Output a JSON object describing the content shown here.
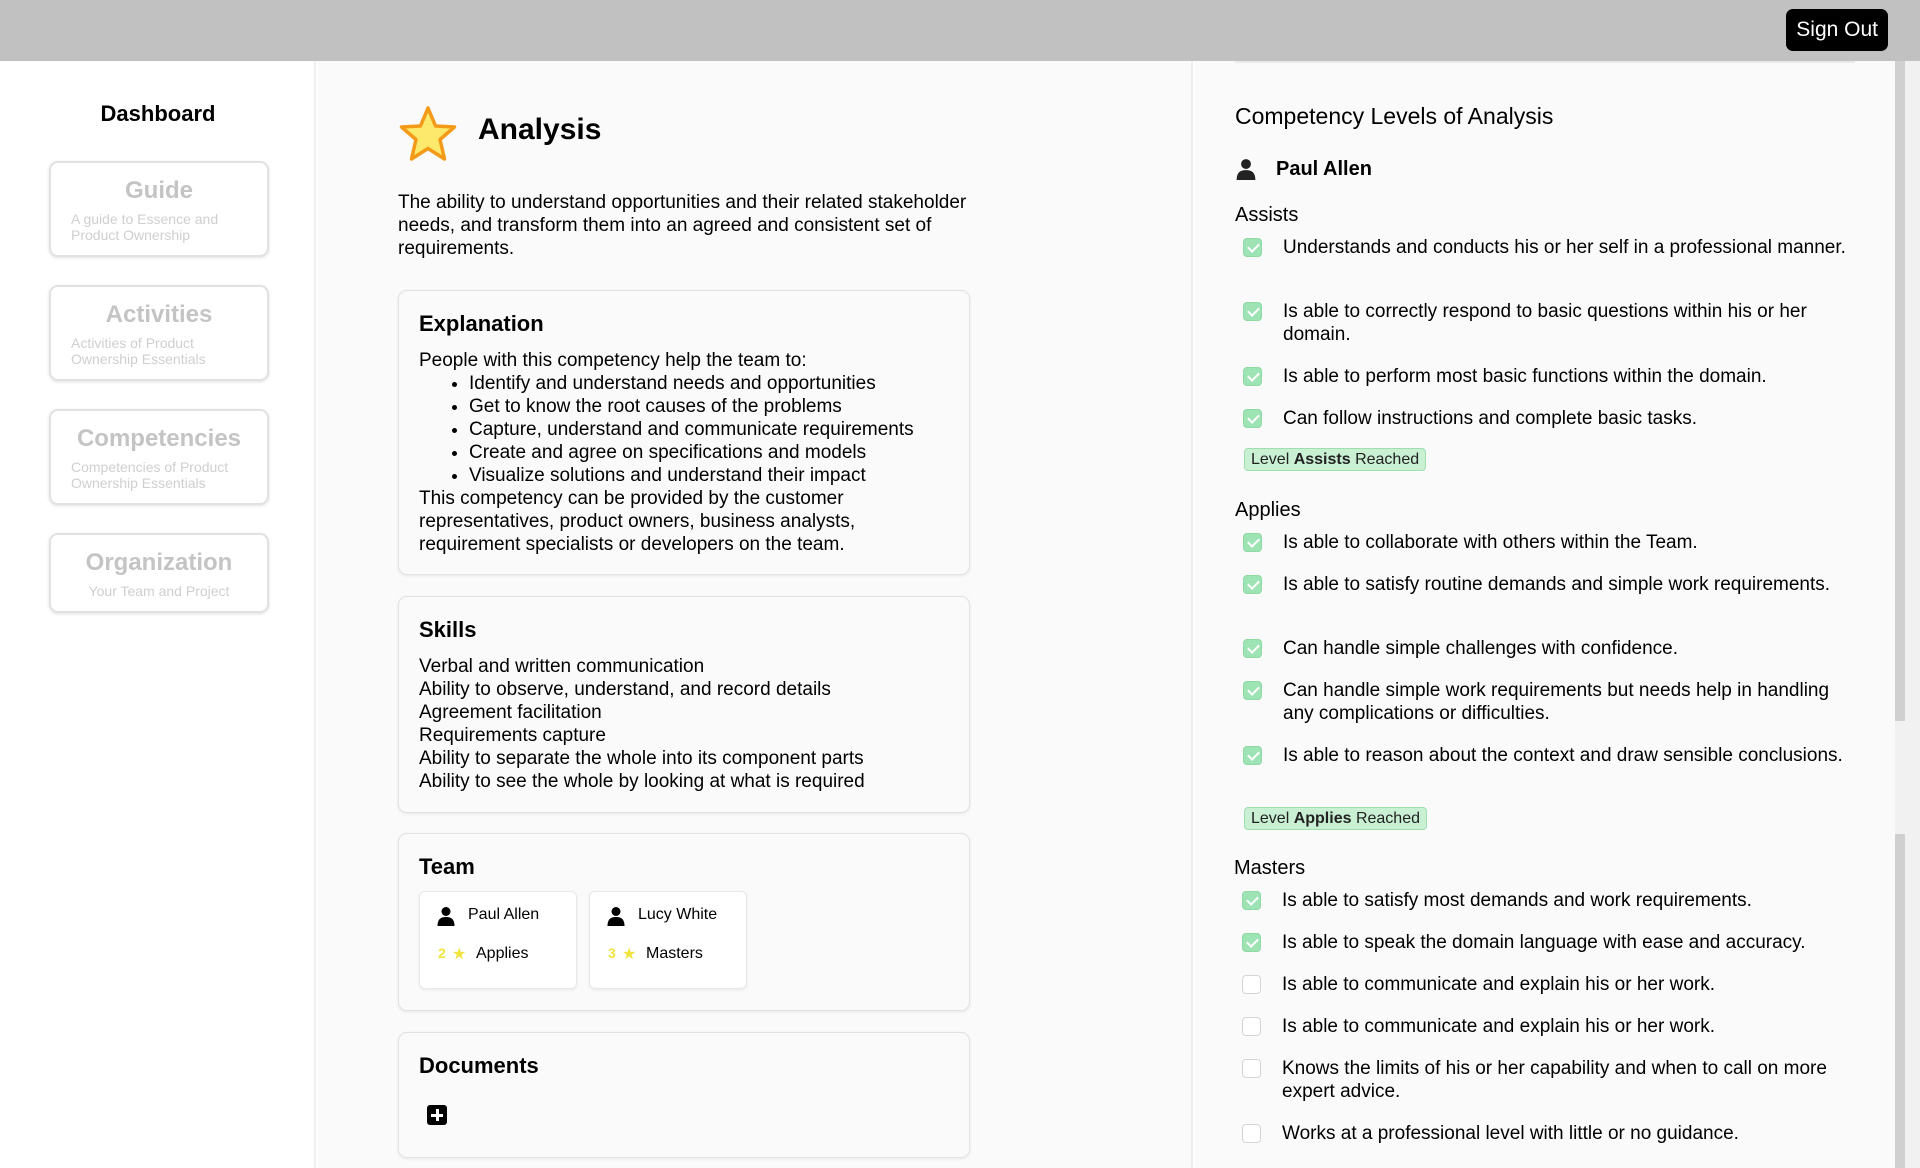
{
  "header": {
    "sign_out": "Sign Out"
  },
  "sidebar": {
    "title": "Dashboard",
    "items": [
      {
        "title": "Guide",
        "subtitle": "A guide to Essence and Product Ownership"
      },
      {
        "title": "Activities",
        "subtitle": "Activities of Product Ownership Essentials"
      },
      {
        "title": "Competencies",
        "subtitle": "Competencies of Product Ownership Essentials"
      },
      {
        "title": "Organization",
        "subtitle": "Your Team and Project"
      }
    ]
  },
  "main": {
    "icon": "star-icon",
    "title": "Analysis",
    "description": "The ability to understand opportunities and their related stakeholder needs, and transform them into an agreed and consistent set of requirements.",
    "explanation": {
      "heading": "Explanation",
      "intro": "People with this competency help the team to:",
      "bullets": [
        "Identify and understand needs and opportunities",
        "Get to know the root causes of the problems",
        "Capture, understand and communicate requirements",
        "Create and agree on specifications and models",
        "Visualize solutions and understand their impact"
      ],
      "outro": "This competency can be provided by the customer representatives, product owners, business analysts, requirement specialists or developers on the team."
    },
    "skills": {
      "heading": "Skills",
      "items": [
        "Verbal and written communication",
        "Ability to observe, understand, and record details",
        "Agreement facilitation",
        "Requirements capture",
        "Ability to separate the whole into its component parts",
        "Ability to see the whole by looking at what is required"
      ]
    },
    "team": {
      "heading": "Team",
      "members": [
        {
          "name": "Paul Allen",
          "level_num": "2",
          "level": "Applies"
        },
        {
          "name": "Lucy White",
          "level_num": "3",
          "level": "Masters"
        }
      ]
    },
    "documents": {
      "heading": "Documents",
      "add_icon": "plus-square-icon"
    }
  },
  "right": {
    "title": "Competency Levels of Analysis",
    "person": "Paul Allen",
    "levels": [
      {
        "name": "Assists",
        "items": [
          {
            "text": "Understands and conducts his or her self in a professional manner.",
            "checked": true
          },
          {
            "text": "Is able to correctly respond to basic questions within his or her domain.",
            "checked": true
          },
          {
            "text": "Is able to perform most basic functions within the domain.",
            "checked": true
          },
          {
            "text": "Can follow instructions and complete basic tasks.",
            "checked": true
          }
        ],
        "badge": {
          "pre": "Level ",
          "level": "Assists",
          "post": " Reached"
        }
      },
      {
        "name": "Applies",
        "items": [
          {
            "text": "Is able to collaborate with others within the Team.",
            "checked": true
          },
          {
            "text": "Is able to satisfy routine demands and simple work requirements.",
            "checked": true
          },
          {
            "text": "Can handle simple challenges with confidence.",
            "checked": true
          },
          {
            "text": "Can handle simple work requirements but needs help in handling any complications or difficulties.",
            "checked": true
          },
          {
            "text": "Is able to reason about the context and draw sensible conclusions.",
            "checked": true
          }
        ],
        "badge": {
          "pre": "Level ",
          "level": "Applies",
          "post": " Reached"
        }
      },
      {
        "name": "Masters",
        "items": [
          {
            "text": "Is able to satisfy most demands and work requirements.",
            "checked": true
          },
          {
            "text": "Is able to speak the domain language with ease and accuracy.",
            "checked": true
          },
          {
            "text": "Is able to communicate and explain his or her work.",
            "checked": false
          },
          {
            "text": "Is able to communicate and explain his or her work.",
            "checked": false
          },
          {
            "text": "Knows the limits of his or her capability and when to call on more expert advice.",
            "checked": false
          },
          {
            "text": "Works at a professional level with little or no guidance.",
            "checked": false
          }
        ]
      }
    ]
  }
}
